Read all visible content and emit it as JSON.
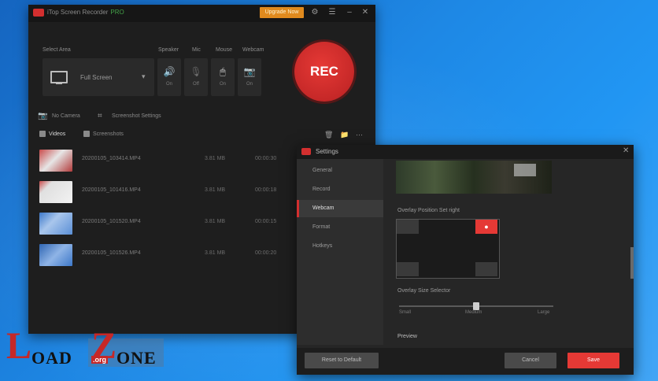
{
  "app": {
    "title": "iTop Screen Recorder",
    "edition": "PRO",
    "upgrade_label": "Upgrade Now"
  },
  "record_controls": {
    "area_label": "Select Area",
    "area_value": "Full Screen",
    "controls": [
      {
        "label": "Speaker",
        "icon": "speaker-icon",
        "state": "On"
      },
      {
        "label": "Mic",
        "icon": "mic-icon",
        "state": "Off"
      },
      {
        "label": "Mouse",
        "icon": "mouse-icon",
        "state": "On"
      },
      {
        "label": "Webcam",
        "icon": "webcam-icon",
        "state": "On"
      }
    ],
    "rec_label": "REC"
  },
  "tools": {
    "no_camera": "No Camera",
    "screenshot_hint": "Screenshot Settings"
  },
  "tabs": [
    {
      "label": "Videos",
      "active": true
    },
    {
      "label": "Screenshots",
      "active": false
    }
  ],
  "recordings": [
    {
      "name": "20200105_103414.MP4",
      "size": "3.81 MB",
      "duration": "00:00:30",
      "color": "#c94a4a"
    },
    {
      "name": "20200105_101416.MP4",
      "size": "3.81 MB",
      "duration": "00:00:18",
      "color": "#d6d6d6"
    },
    {
      "name": "20200105_101520.MP4",
      "size": "3.81 MB",
      "duration": "00:00:15",
      "color": "#5b8fd6"
    },
    {
      "name": "20200105_101526.MP4",
      "size": "3.81 MB",
      "duration": "00:00:20",
      "color": "#3d78c9"
    }
  ],
  "settings": {
    "title": "Settings",
    "nav": [
      "General",
      "Record",
      "Webcam",
      "Format",
      "Hotkeys"
    ],
    "active_nav": "Webcam",
    "overlay_position_label": "Overlay Position Set right",
    "overlay_size_label": "Overlay Size Selector",
    "size_labels": [
      "Small",
      "Medium",
      "Large"
    ],
    "size_value": "Medium",
    "preview_label": "Preview",
    "reset_label": "Reset to Default",
    "cancel_label": "Cancel",
    "save_label": "Save"
  },
  "watermark": {
    "left": "L",
    "word1": "OAD",
    "z": "Z",
    "word2": "ONE",
    "org": ".org"
  }
}
